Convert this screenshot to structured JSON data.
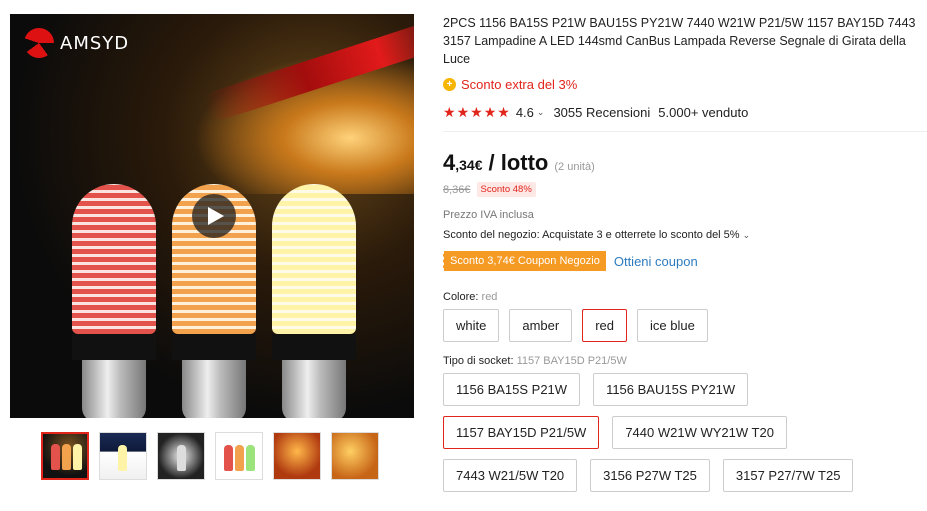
{
  "gallery": {
    "brand": "AMSYD",
    "thumbnails": [
      "thumb-1",
      "thumb-2",
      "thumb-3",
      "thumb-4",
      "thumb-5",
      "thumb-6"
    ]
  },
  "product": {
    "title": "2PCS 1156 BA15S P21W BAU15S PY21W 7440 W21W P21/5W 1157 BAY15D 7443 3157 Lampadine A LED 144smd CanBus Lampada Reverse Segnale di Girata della Luce",
    "extra_discount": "Sconto extra del 3%",
    "rating": "4.6",
    "reviews": "3055 Recensioni",
    "sold": "5.000+ venduto",
    "price_int": "4",
    "price_dec": ",34€",
    "price_unit": "/ lotto",
    "price_qty": "(2 unità)",
    "old_price": "8,36€",
    "discount": "Sconto 48%",
    "vat": "Prezzo IVA inclusa",
    "store_discount": "Sconto del negozio: Acquistate 3 e otterrete lo sconto del 5%",
    "coupon": "Sconto 3,74€ Coupon Negozio",
    "coupon_link": "Ottieni coupon"
  },
  "color": {
    "label": "Colore:",
    "selected": "red",
    "options": [
      "white",
      "amber",
      "red",
      "ice blue"
    ]
  },
  "socket": {
    "label": "Tipo di socket:",
    "selected": "1157 BAY15D P21/5W",
    "options": [
      "1156 BA15S P21W",
      "1156 BAU15S PY21W",
      "1157 BAY15D P21/5W",
      "7440 W21W WY21W T20",
      "7443 W21/5W T20",
      "3156 P27W T25",
      "3157 P27/7W T25"
    ]
  },
  "colors": {
    "accent": "#e1251b",
    "coupon": "#f59a23",
    "link": "#2d7bbf"
  }
}
